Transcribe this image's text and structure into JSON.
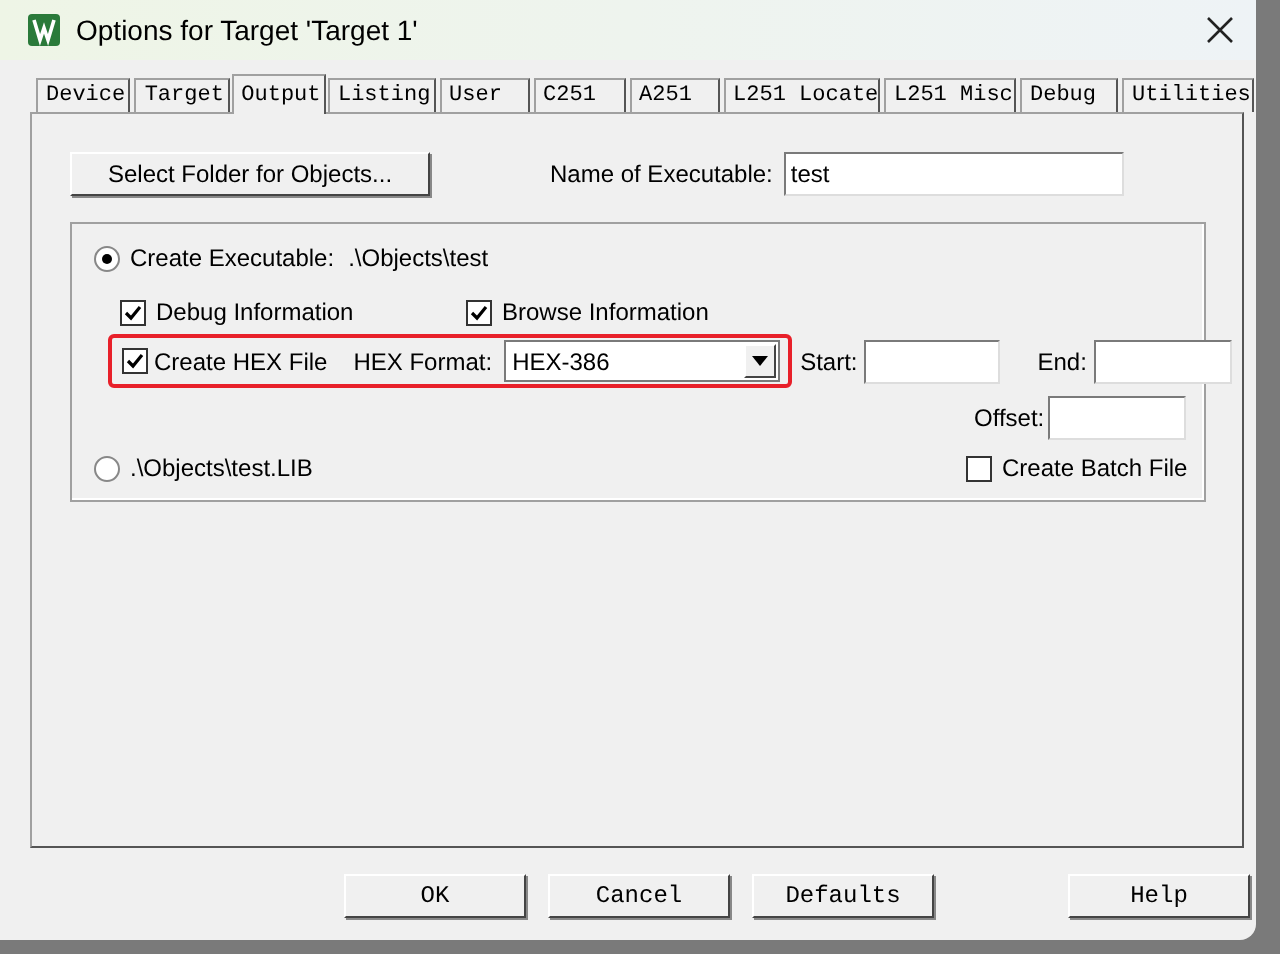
{
  "window": {
    "title": "Options for Target 'Target 1'"
  },
  "tabs": [
    {
      "label": "Device",
      "selected": false
    },
    {
      "label": "Target",
      "selected": false
    },
    {
      "label": "Output",
      "selected": true
    },
    {
      "label": "Listing",
      "selected": false
    },
    {
      "label": "User",
      "selected": false
    },
    {
      "label": "C251",
      "selected": false
    },
    {
      "label": "A251",
      "selected": false
    },
    {
      "label": "L251 Locate",
      "selected": false
    },
    {
      "label": "L251 Misc",
      "selected": false
    },
    {
      "label": "Debug",
      "selected": false
    },
    {
      "label": "Utilities",
      "selected": false
    }
  ],
  "output": {
    "select_folder_button": "Select Folder for Objects...",
    "executable_name": {
      "label": "Name of Executable:",
      "value": "test"
    },
    "create_executable": {
      "label": "Create Executable:",
      "path": ".\\Objects\\test",
      "selected": true
    },
    "debug_information": {
      "label": "Debug Information",
      "checked": true
    },
    "browse_information": {
      "label": "Browse Information",
      "checked": true
    },
    "create_hex_file": {
      "label": "Create HEX File",
      "checked": true,
      "highlighted": true
    },
    "hex_format": {
      "label": "HEX Format:",
      "value": "HEX-386"
    },
    "start": {
      "label": "Start:"
    },
    "end": {
      "label": "End:"
    },
    "offset": {
      "label": "Offset:"
    },
    "create_library": {
      "label": ".\\Objects\\test.LIB",
      "selected": false
    },
    "create_batch_file": {
      "label": "Create Batch File",
      "checked": false
    }
  },
  "buttons": [
    {
      "label": "OK"
    },
    {
      "label": "Cancel"
    },
    {
      "label": "Defaults"
    },
    {
      "label": "Help",
      "spaced": true
    }
  ]
}
